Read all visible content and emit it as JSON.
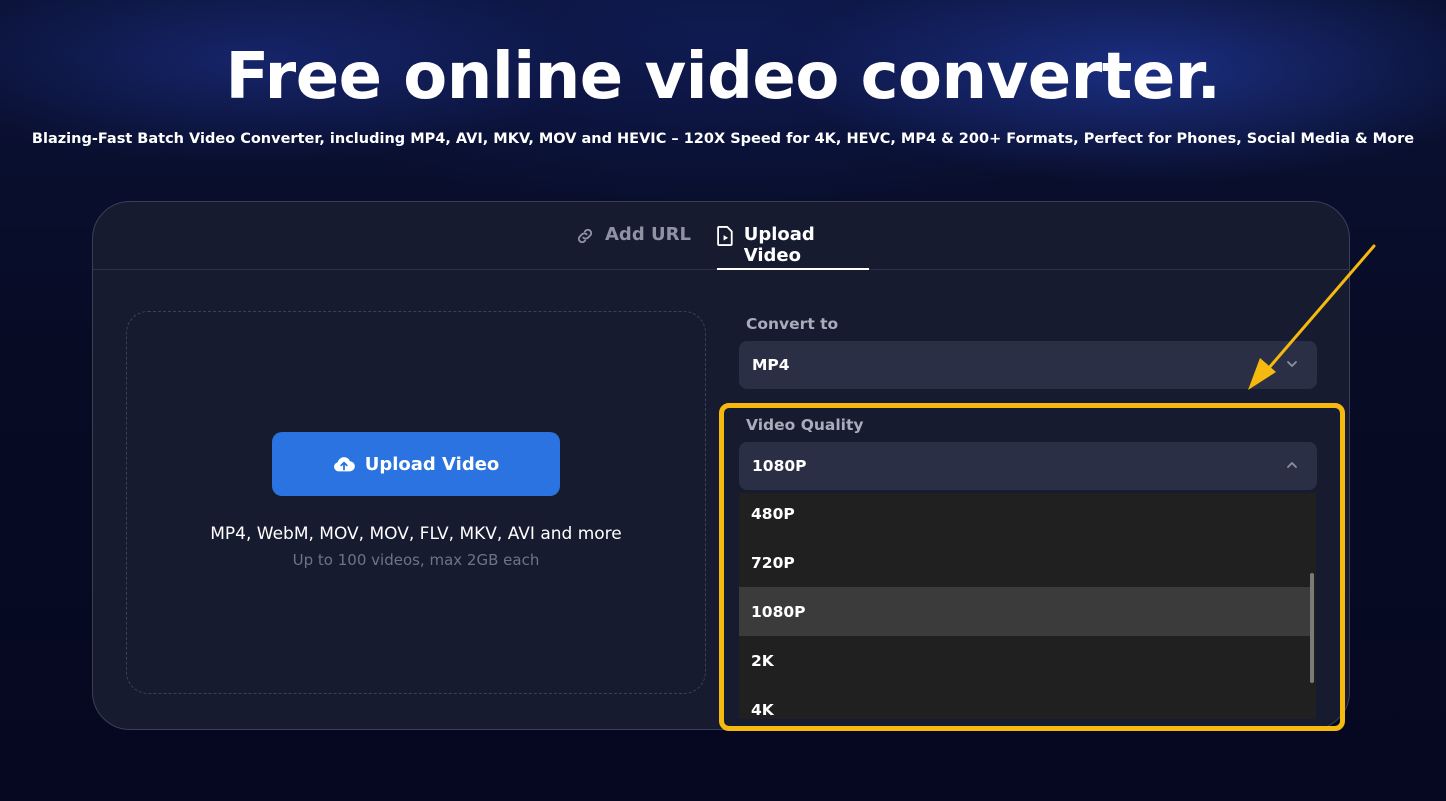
{
  "hero": {
    "title": "Free online video converter.",
    "subtitle": "Blazing-Fast Batch Video Converter, including MP4, AVI, MKV, MOV and HEVIC – 120X Speed for 4K, HEVC, MP4 & 200+ Formats, Perfect for Phones, Social Media & More"
  },
  "tabs": [
    {
      "label": "Add URL",
      "icon": "link-icon",
      "active": false
    },
    {
      "label": "Upload Video",
      "icon": "file-icon",
      "active": true
    }
  ],
  "upload": {
    "button_label": "Upload Video",
    "button_icon": "cloud-upload-icon",
    "formats_text": "MP4, WebM, MOV, MOV, FLV, MKV, AVI and more",
    "limits_text": "Up to 100 videos, max 2GB each"
  },
  "convert_to": {
    "label": "Convert to",
    "value": "MP4"
  },
  "video_quality": {
    "label": "Video Quality",
    "value": "1080P",
    "options": [
      "480P",
      "720P",
      "1080P",
      "2K",
      "4K"
    ],
    "selected_option": "1080P"
  },
  "colors": {
    "accent_button": "#2a73e0",
    "highlight_box": "#f5b90f",
    "background": "#070b24"
  }
}
